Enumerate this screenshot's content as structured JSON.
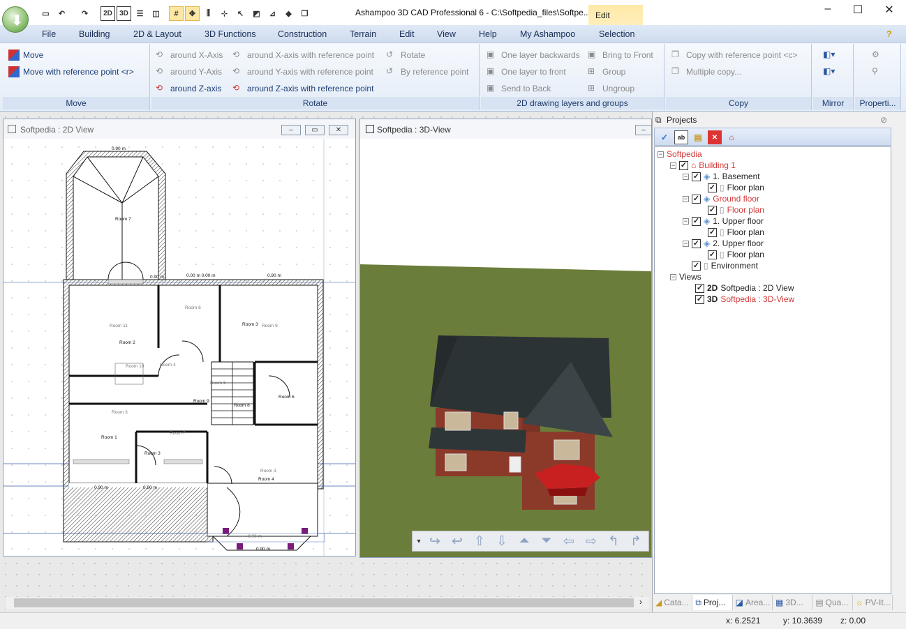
{
  "window": {
    "title": "Ashampoo 3D CAD Professional 6 - C:\\Softpedia_files\\Softpe...",
    "context_tab": "Edit",
    "controls": {
      "minimize": "–",
      "maximize": "☐",
      "close": "✕"
    }
  },
  "qat": [
    "2D",
    "3D"
  ],
  "menu": [
    "File",
    "Building",
    "2D & Layout",
    "3D Functions",
    "Construction",
    "Terrain",
    "Edit",
    "View",
    "Help",
    "My Ashampoo",
    "Selection"
  ],
  "ribbon": {
    "move": {
      "label": "Move",
      "items": [
        "Move",
        "Move with reference point <r>"
      ]
    },
    "rotate": {
      "label": "Rotate",
      "items": [
        "around X-Axis",
        "around Y-Axis",
        "around Z-axis",
        "around X-axis with reference point",
        "around Y-axis with reference point",
        "around Z-axis with reference point",
        "Rotate",
        "By reference point"
      ]
    },
    "layers": {
      "label": "2D drawing layers and groups",
      "items": [
        "One layer backwards",
        "One layer to front",
        "Send to Back",
        "Bring to Front",
        "Group",
        "Ungroup"
      ]
    },
    "copy": {
      "label": "Copy",
      "items": [
        "Copy with reference point <c>",
        "Multiple copy..."
      ]
    },
    "mirror": {
      "label": "Mirror"
    },
    "properties": {
      "label": "Properti..."
    }
  },
  "view2d": {
    "title": "Softpedia : 2D View",
    "rooms": [
      "Room 7",
      "Room 11",
      "Room 2",
      "Room 6",
      "Room 3",
      "Room 9",
      "Room 10",
      "Room 4",
      "Room 5",
      "Room 9",
      "Room 8",
      "Room 6",
      "Room 1",
      "Room 3",
      "Room 3",
      "Room 4",
      "Room 7",
      "Room 3"
    ],
    "dims": [
      "0.90 m",
      "0.90 m",
      "0.00 m 0.00 m",
      "0.90 m",
      "0.90 m",
      "0.90 m",
      "0.90 m",
      "0.90 m"
    ]
  },
  "view3d": {
    "title": "Softpedia : 3D-View"
  },
  "projects": {
    "title": "Projects",
    "tree": [
      {
        "label": "Softpedia",
        "red": true
      },
      {
        "label": "Building 1",
        "red": true
      },
      {
        "label": "1. Basement"
      },
      {
        "label": "Floor plan"
      },
      {
        "label": "Ground floor",
        "red": true
      },
      {
        "label": "Floor plan",
        "red": true
      },
      {
        "label": "1. Upper floor"
      },
      {
        "label": "Floor plan"
      },
      {
        "label": "2. Upper floor"
      },
      {
        "label": "Floor plan"
      },
      {
        "label": "Environment"
      },
      {
        "label": "Views"
      },
      {
        "label": "Softpedia : 2D View",
        "tag": "2D"
      },
      {
        "label": "Softpedia : 3D-View",
        "tag": "3D",
        "red": true
      }
    ],
    "tabs": [
      "Cata...",
      "Proj...",
      "Area...",
      "3D...",
      "Qua...",
      "PV-It..."
    ]
  },
  "status": {
    "x": "x: 6.2521",
    "y": "y: 10.3639",
    "z": "z: 0.00"
  }
}
